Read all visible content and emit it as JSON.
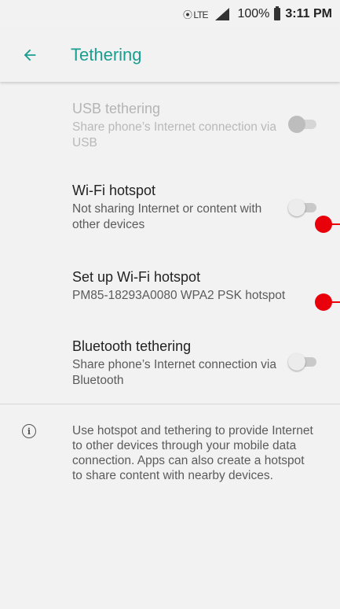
{
  "status_bar": {
    "network_icons": "⦿ LTE",
    "battery_percent": "100%",
    "time": "3:11 PM"
  },
  "toolbar": {
    "back_icon": "arrow-left-icon",
    "title": "Tethering",
    "accent_color": "#1a9e8f"
  },
  "items": [
    {
      "title": "USB tethering",
      "subtitle": "Share phone’s Internet connection via USB",
      "toggle": "off",
      "enabled": false
    },
    {
      "title": "Wi-Fi hotspot",
      "subtitle": "Not sharing Internet or content with other devices",
      "toggle": "off",
      "enabled": true
    },
    {
      "title": "Set up Wi-Fi hotspot",
      "subtitle": "PM85-18293A0080 WPA2 PSK hotspot",
      "enabled": true
    },
    {
      "title": "Bluetooth tethering",
      "subtitle": "Share phone’s Internet connection via Bluetooth",
      "toggle": "off",
      "enabled": true
    }
  ],
  "info": {
    "icon": "info-icon",
    "text": "Use hotspot and tethering to provide Internet to other devices through your mobile data connection. Apps can also create a hotspot to share content with nearby devices."
  },
  "marker_color": "#e8000b"
}
